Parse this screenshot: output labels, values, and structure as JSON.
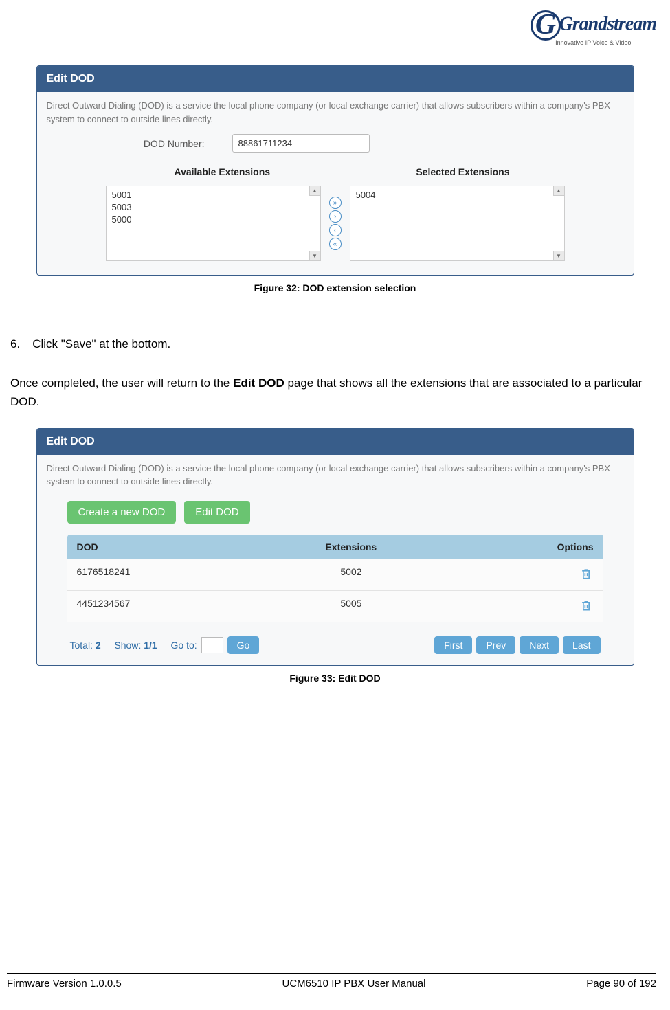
{
  "logo": {
    "brand_name": "Grandstream",
    "tagline": "Innovative IP Voice & Video"
  },
  "figure32": {
    "panel_title": "Edit DOD",
    "description": "Direct Outward Dialing (DOD) is a service the local phone company (or local exchange carrier) that allows subscribers within a company's PBX system to connect to outside lines directly.",
    "dod_number_label": "DOD Number:",
    "dod_number_value": "88861711234",
    "available_header": "Available Extensions",
    "selected_header": "Selected Extensions",
    "available_extensions": [
      "5001",
      "5003",
      "5000"
    ],
    "selected_extensions": [
      "5004"
    ],
    "caption": "Figure 32: DOD extension selection"
  },
  "body": {
    "step_number": "6.",
    "step_text": "Click \"Save\" at the bottom.",
    "para_pre": "Once completed, the user will return to the ",
    "para_bold": "Edit DOD",
    "para_post": " page that shows all the extensions that are associated to a particular DOD."
  },
  "figure33": {
    "panel_title": "Edit DOD",
    "description": "Direct Outward Dialing (DOD) is a service the local phone company (or local exchange carrier) that allows subscribers within a company's PBX system to connect to outside lines directly.",
    "btn_create": "Create a new DOD",
    "btn_edit": "Edit DOD",
    "col_dod": "DOD",
    "col_ext": "Extensions",
    "col_opt": "Options",
    "rows": [
      {
        "dod": "6176518241",
        "ext": "5002"
      },
      {
        "dod": "4451234567",
        "ext": "5005"
      }
    ],
    "total_label": "Total:",
    "total_value": "2",
    "show_label": "Show:",
    "show_value": "1/1",
    "goto_label": "Go to:",
    "btn_go": "Go",
    "btn_first": "First",
    "btn_prev": "Prev",
    "btn_next": "Next",
    "btn_last": "Last",
    "caption": "Figure 33: Edit DOD"
  },
  "footer": {
    "left": "Firmware Version 1.0.0.5",
    "center": "UCM6510 IP PBX User Manual",
    "right": "Page 90 of 192"
  }
}
